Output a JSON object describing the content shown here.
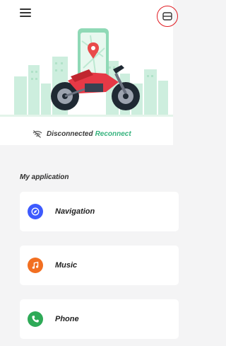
{
  "header": {
    "menu_icon": "hamburger-menu-icon",
    "side_icon": "panel-toggle-icon",
    "side_icon_highlight": "#e11b22"
  },
  "hero": {
    "illustration": "motorcycle-with-phone-map-illustration",
    "status_icon": "wifi-off-icon",
    "status_text": "Disconnected",
    "reconnect_label": "Reconnect",
    "reconnect_color": "#36b37e"
  },
  "section": {
    "title": "My application"
  },
  "apps": [
    {
      "label": "Navigation",
      "icon": "navigation-icon",
      "color": "#3d5afe"
    },
    {
      "label": "Music",
      "icon": "music-icon",
      "color": "#f26f21"
    },
    {
      "label": "Phone",
      "icon": "phone-icon",
      "color": "#2eaa57"
    }
  ]
}
